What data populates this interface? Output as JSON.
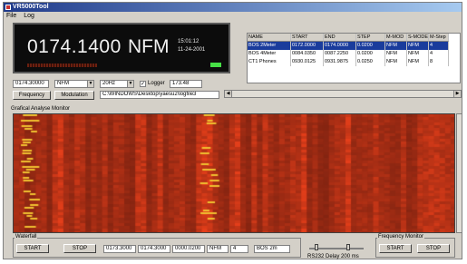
{
  "window": {
    "title": "VR5000Tool"
  },
  "menu": [
    "File",
    "Log"
  ],
  "display": {
    "frequency": "0174.1400",
    "mode": "NFM",
    "time": "15:01:12",
    "date": "11-24-2001",
    "signal_level": 0.55
  },
  "controls": {
    "freq_input": "0174.30000",
    "mode_select": "NFM",
    "step_select": "20Hz",
    "logger_label": "Logger",
    "logger_checked": true,
    "logger_value": "173.48",
    "frequency_button": "Frequency",
    "modulation_button": "Modulation",
    "path": "C:\\WINDOWS\\Desktop\\yaesu2\\logfile3"
  },
  "table": {
    "headers": [
      "NAME",
      "START",
      "END",
      "STEP",
      "M-MOD",
      "S-MODE",
      "M-Step"
    ],
    "rows": [
      [
        "BOS 2Meter",
        "0172.0000",
        "0174.0000",
        "0.0200",
        "NFM",
        "NFM",
        "4"
      ],
      [
        "BOS 4Meter",
        "0084.0350",
        "0087.2250",
        "0.0200",
        "NFM",
        "NFM",
        "4"
      ],
      [
        "CT1 Phones",
        "0930.0125",
        "0931.9875",
        "0.0250",
        "NFM",
        "NFM",
        "8"
      ]
    ]
  },
  "monitor": {
    "title": "Grafical Analyse Monitor"
  },
  "bottom": {
    "waterfall_label": "Waterfall",
    "start_button": "START",
    "stop_button": "STOP",
    "start_freq": "0173.3000",
    "end_freq": "0174.3000",
    "step": "0000.0200",
    "mode": "NFM",
    "mstep": "4",
    "name": "BOS 2m",
    "delay_label": "RS232 Delay 200 ms",
    "freq_monitor_label": "Frequency Monitor",
    "fm_start_button": "START",
    "fm_stop_button": "STOP"
  },
  "colors": {
    "background": "#8c2a14",
    "hot": "#f0c030",
    "display_bg": "#0c0c0c",
    "selection": "#1a3c9c"
  }
}
